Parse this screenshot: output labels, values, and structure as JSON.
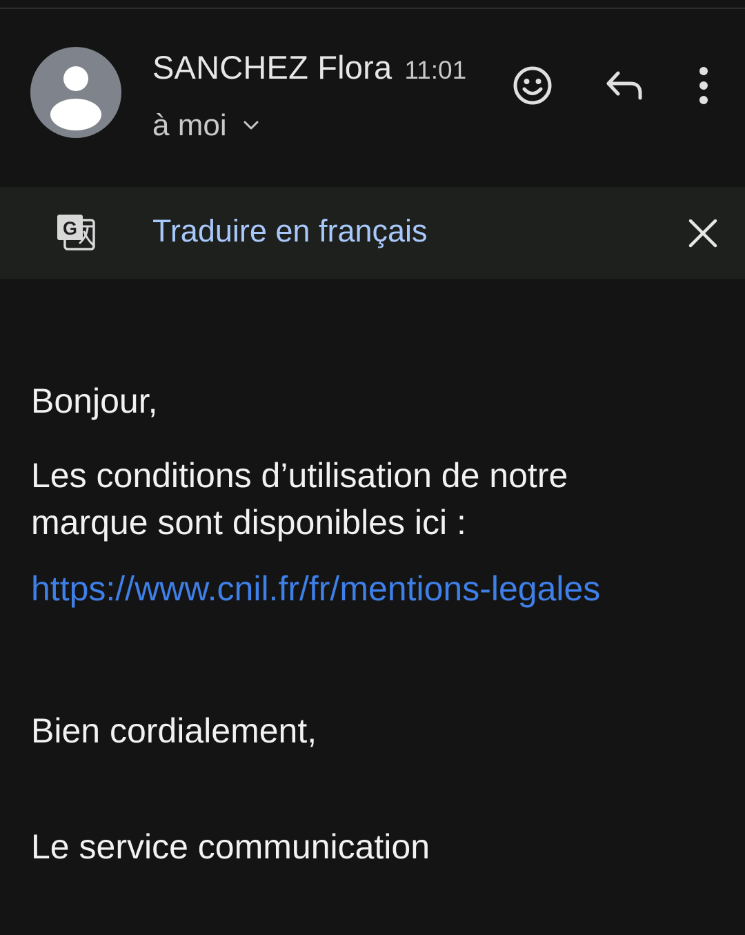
{
  "header": {
    "sender_name": "SANCHEZ Flora",
    "time": "11:01",
    "recipient": "à moi",
    "avatar": "person-icon",
    "actions": [
      "emoji-reaction-icon",
      "reply-icon",
      "more-vert-icon"
    ]
  },
  "translate_bar": {
    "icon": "google-translate-icon",
    "label": "Traduire en français",
    "close_icon": "close-icon"
  },
  "message": {
    "greeting": "Bonjour,",
    "paragraph": "Les conditions d’utilisation de notre marque sont disponibles ici :",
    "link": "https://www.cnil.fr/fr/mentions-legales",
    "closing": "Bien cordialement,",
    "signature": "Le service communication"
  },
  "colors": {
    "background": "#131413",
    "translate_bar": "#1d201d",
    "link": "#3f7fe8",
    "translate_link": "#a8c7fa",
    "avatar": "#7f838b"
  }
}
